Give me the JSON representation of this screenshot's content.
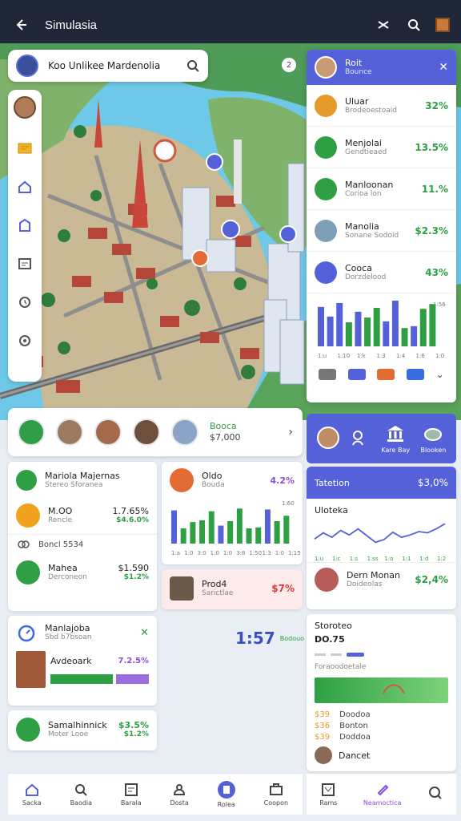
{
  "app": {
    "title": "Simulasia"
  },
  "search": {
    "query": "Koo Unlikee Mardenolia"
  },
  "help_badge": "2",
  "right_panel": {
    "header": {
      "title": "Roit",
      "subtitle": "Bounce"
    },
    "rows": [
      {
        "name": "Uluar",
        "detail": "Brodeoestoaid",
        "pct": "32%",
        "color": "#e69a2a"
      },
      {
        "name": "Menjolai",
        "detail": "Gendtieaed",
        "pct": "13.5%",
        "color": "#2ea043"
      },
      {
        "name": "Manloonan",
        "detail": "Corioa lon",
        "pct": "11.%",
        "color": "#2ea043"
      },
      {
        "name": "Manolia",
        "detail": "Sonane Sodoid",
        "pct": "$2.3%",
        "color": "#7da0b8"
      },
      {
        "name": "Cooca",
        "detail": "Dorzdelood",
        "pct": "43%",
        "color": "#5561d8"
      }
    ],
    "chart_bars": [
      0.82,
      0.62,
      0.9,
      0.5,
      0.72,
      0.6,
      0.8,
      0.52,
      0.95,
      0.38,
      0.42,
      0.78,
      0.88
    ],
    "chart_colors": [
      "#5561d8",
      "#5561d8",
      "#5561d8",
      "#2ea043",
      "#5561d8",
      "#2ea043",
      "#2ea043",
      "#5561d8",
      "#5561d8",
      "#2ea043",
      "#5561d8",
      "#2ea043",
      "#2ea043"
    ],
    "chart_ticks": [
      "1:u",
      "1:10",
      "1:k",
      "1:3",
      "1:4",
      "1:6",
      "1:0"
    ],
    "chart_corner": "1:56"
  },
  "strip": {
    "label": "Booca",
    "value": "$7,000"
  },
  "blue_strip": [
    {
      "label": ""
    },
    {
      "label": ""
    },
    {
      "label": "Kare Bay"
    },
    {
      "label": "Blooken"
    }
  ],
  "card_left": {
    "title": "Mariola Majernas",
    "subtitle": "Stereo Sforanea",
    "item1": {
      "name": "M.OO",
      "detail": "Rencle",
      "v1": "1.7.65%",
      "v2": "$4.6.0%"
    },
    "section": "Boncl 5534",
    "item2": {
      "name": "Mahea",
      "detail": "Derconeon",
      "v1": "$1.590",
      "v2": "$1.2%"
    }
  },
  "card_bars": {
    "title": "Oldo",
    "subtitle": "Bouda",
    "pct": "4.2%",
    "bars": [
      0.74,
      0.34,
      0.48,
      0.52,
      0.72,
      0.4,
      0.5,
      0.78,
      0.34,
      0.36,
      0.76,
      0.5,
      0.62
    ],
    "ticks": [
      "1:a",
      "1:0",
      "3:0",
      "1:0",
      "1:0",
      "3:8",
      "1:50",
      "1:3",
      "1:0",
      "1:15"
    ],
    "corner": "1:60"
  },
  "card_highlight": {
    "name": "Prod4",
    "detail": "Sarictlae",
    "pct": "$7%"
  },
  "right_line": {
    "title": "Tatetion",
    "value": "$3,0%",
    "label": "Uloteka",
    "ticks": [
      "1:u",
      "1:c",
      "1:s",
      "1:ss",
      "1:o",
      "1:1",
      "1:d",
      "1:2"
    ],
    "series": [
      0.6,
      0.42,
      0.55,
      0.35,
      0.48,
      0.3,
      0.5,
      0.7,
      0.62,
      0.4,
      0.55,
      0.48,
      0.38,
      0.42,
      0.3,
      0.15
    ],
    "person_name": "Dern Monan",
    "person_detail": "Doideolas",
    "person_pct": "$2,4%"
  },
  "alert_card": {
    "title": "Manlajoba",
    "subtitle": "Sbd b7bsoan",
    "item_name": "Avdeoark",
    "item_pct": "7.2.5%",
    "progress": 0.64,
    "progress2": 0.28
  },
  "middle_stat": {
    "value": "1:57",
    "sub": "Bodouo"
  },
  "last_card": {
    "name": "Samalhinnick",
    "detail": "Moter Looe",
    "v1": "$3.5%",
    "v2": "$1.2%"
  },
  "stats_card": {
    "title": "Storoteo",
    "value": "DO.75",
    "label": "Foraoodoetale",
    "rows": [
      {
        "v": "$39",
        "t": "Doodoa"
      },
      {
        "v": "$36",
        "t": "Bonton"
      },
      {
        "v": "$39",
        "t": "Doddoa"
      }
    ],
    "person": "Dancet"
  },
  "bottom_nav": [
    {
      "label": "Sacka",
      "active": false
    },
    {
      "label": "Baodia",
      "active": false
    },
    {
      "label": "Barala",
      "active": false
    },
    {
      "label": "Dosta",
      "active": false
    },
    {
      "label": "Rolea",
      "active": true
    },
    {
      "label": "Coopon",
      "active": false
    }
  ],
  "bottom_nav2": [
    {
      "label": "Rams"
    },
    {
      "label": "Neamoctica"
    },
    {
      "label": ""
    }
  ]
}
